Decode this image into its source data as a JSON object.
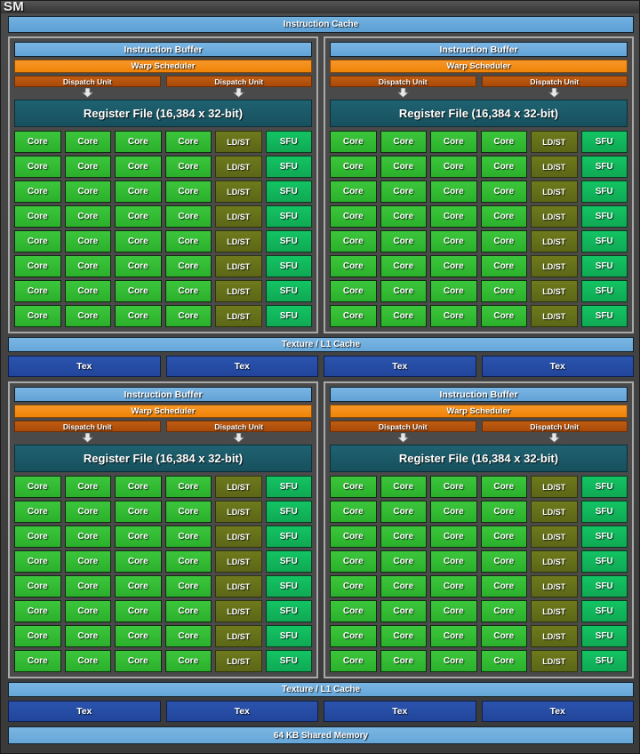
{
  "chip": {
    "title": "SM",
    "instruction_cache": "Instruction Cache",
    "shared_memory": "64 KB Shared Memory"
  },
  "labels": {
    "instruction_buffer": "Instruction Buffer",
    "warp_scheduler": "Warp Scheduler",
    "dispatch_unit": "Dispatch Unit",
    "register_file": "Register File (16,384 x 32-bit)",
    "core": "Core",
    "ldst": "LD/ST",
    "sfu": "SFU",
    "texture_l1_cache": "Texture / L1 Cache",
    "tex": "Tex",
    "arrow": "▼"
  },
  "colors": {
    "cache_blue": "#6aabdd",
    "warp_orange": "#f08a1c",
    "dispatch_orange": "#b85510",
    "register_teal": "#1a5a66",
    "core_green": "#2eb82e",
    "ldst_olive": "#63701a",
    "sfu_green": "#11b85b",
    "tex_blue": "#2449a4",
    "chip_gray": "#3f3f3f",
    "quadrant_border": "#a9a9a9"
  },
  "structure": {
    "quadrant_count": 4,
    "core_rows_per_quadrant": 8,
    "cores_per_row": 4,
    "ldst_per_row": 1,
    "sfu_per_row": 1,
    "dispatch_units_per_quadrant": 2,
    "tex_units_per_block": 4,
    "texture_blocks": 2
  },
  "quadrants": [
    {
      "id": "q1",
      "position": "top-left"
    },
    {
      "id": "q2",
      "position": "top-right"
    },
    {
      "id": "q3",
      "position": "bottom-left"
    },
    {
      "id": "q4",
      "position": "bottom-right"
    }
  ]
}
